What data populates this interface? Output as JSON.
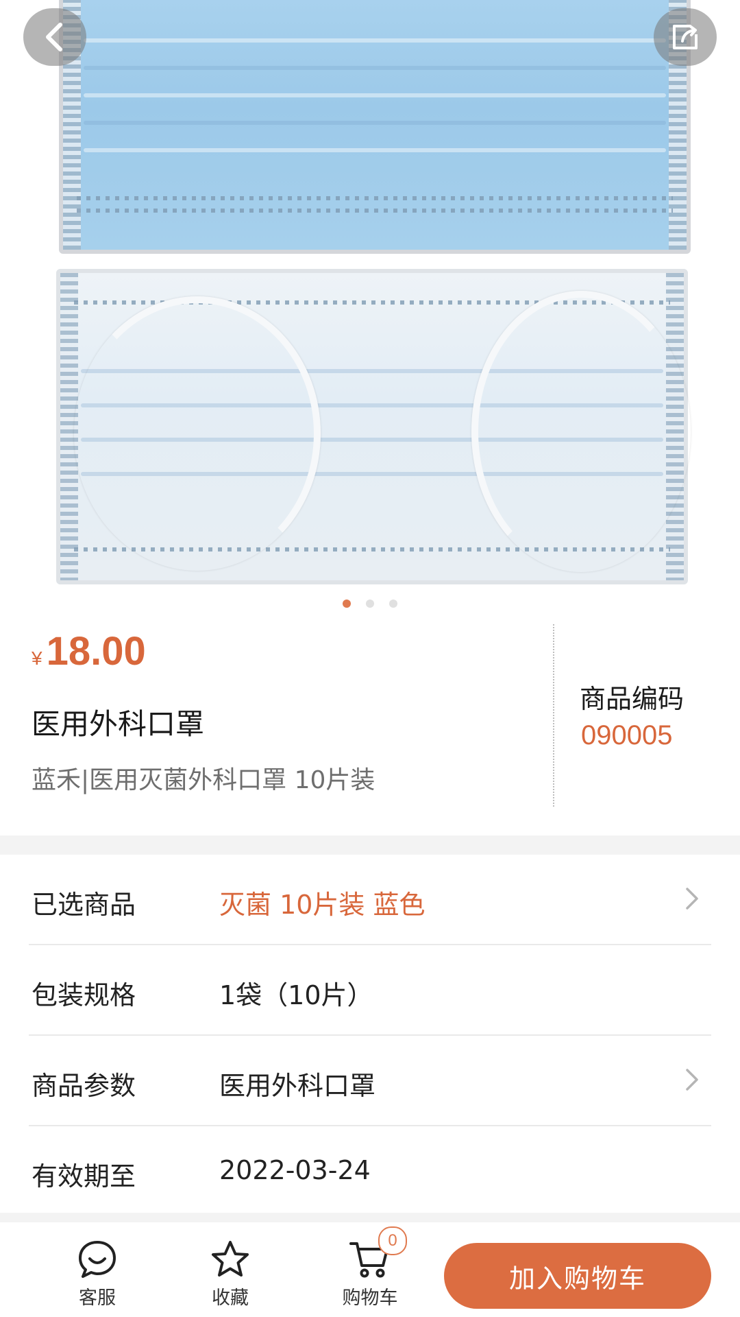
{
  "nav": {
    "back_icon": "chevron-left-icon",
    "share_icon": "share-icon"
  },
  "carousel": {
    "slide_count": 3,
    "active_index": 0
  },
  "product": {
    "currency": "¥",
    "price": "18.00",
    "name": "医用外科口罩",
    "description": "蓝禾|医用灭菌外科口罩 10片装",
    "code_label": "商品编码",
    "code_value": "090005"
  },
  "details": {
    "selected": {
      "label": "已选商品",
      "value": "灭菌 10片装 蓝色"
    },
    "packaging": {
      "label": "包装规格",
      "value": "1袋（10片）"
    },
    "params": {
      "label": "商品参数",
      "value": "医用外科口罩"
    },
    "expiry": {
      "label": "有效期至",
      "value": "2022-03-24"
    }
  },
  "bottom_bar": {
    "service": {
      "label": "客服",
      "icon": "chat-icon"
    },
    "favorite": {
      "label": "收藏",
      "icon": "star-icon"
    },
    "cart": {
      "label": "购物车",
      "icon": "cart-icon",
      "count": "0"
    },
    "add_to_cart": "加入购物车"
  },
  "colors": {
    "accent": "#dc6d41",
    "accent_text": "#d8673b"
  }
}
